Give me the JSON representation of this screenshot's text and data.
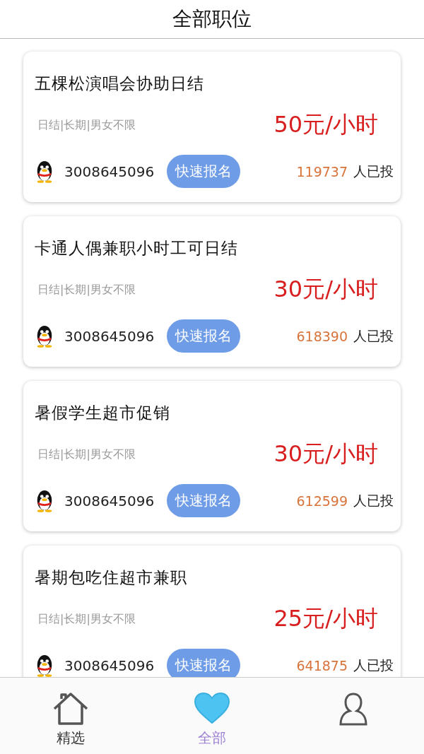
{
  "header": {
    "title": "全部职位"
  },
  "jobs": [
    {
      "title": "五棵松演唱会协助日结",
      "tags": "日结|长期|男女不限",
      "pay": "50元/小时",
      "contact": "3008645096",
      "apply_button": "快速报名",
      "applicants": "119737",
      "applicants_label": "人已投"
    },
    {
      "title": "卡通人偶兼职小时工可日结",
      "tags": "日结|长期|男女不限",
      "pay": "30元/小时",
      "contact": "3008645096",
      "apply_button": "快速报名",
      "applicants": "618390",
      "applicants_label": "人已投"
    },
    {
      "title": "暑假学生超市促销",
      "tags": "日结|长期|男女不限",
      "pay": "30元/小时",
      "contact": "3008645096",
      "apply_button": "快速报名",
      "applicants": "612599",
      "applicants_label": "人已投"
    },
    {
      "title": "暑期包吃住超市兼职",
      "tags": "日结|长期|男女不限",
      "pay": "25元/小时",
      "contact": "3008645096",
      "apply_button": "快速报名",
      "applicants": "641875",
      "applicants_label": "人已投"
    }
  ],
  "tab_bar": [
    {
      "kind": "home",
      "label": "精选",
      "selected": false
    },
    {
      "kind": "heart",
      "label": "全部",
      "selected": true
    },
    {
      "kind": "person",
      "selected": false
    }
  ]
}
